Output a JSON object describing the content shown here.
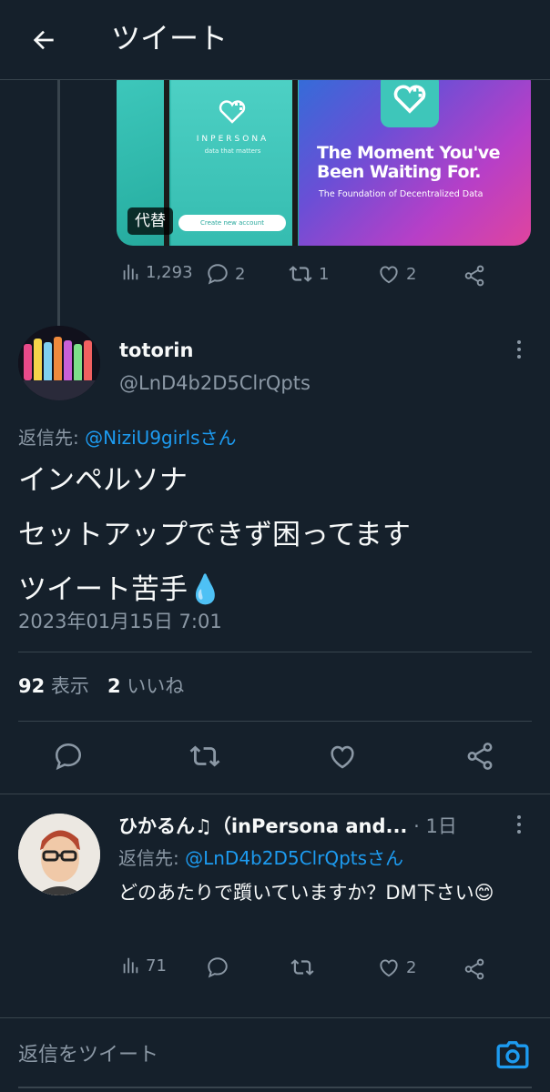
{
  "header": {
    "title": "ツイート",
    "back_icon": "arrow-left-icon"
  },
  "quoted_media": {
    "brand": "INPERSONA",
    "tagline": "data that matters",
    "button": "Create new account",
    "promo_title": "The Moment You've Been Waiting For.",
    "promo_subtitle": "The Foundation of Decentralized Data",
    "alt_badge": "代替"
  },
  "prev_actions": {
    "views": "1,293",
    "replies": "2",
    "retweets": "1",
    "likes": "2"
  },
  "tweet": {
    "display_name": "totorin",
    "username": "@LnD4b2D5ClrQpts",
    "reply_prefix": "返信先: ",
    "reply_handle": "@NiziU9girlsさん",
    "lines": [
      "インペルソナ",
      "セットアップできず困ってます",
      "ツイート苦手💧"
    ],
    "timestamp": "2023年01月15日 7:01",
    "views_count": "92",
    "views_label": "表示",
    "likes_count": "2",
    "likes_label": "いいね"
  },
  "reply": {
    "display_name": "ひかるん♫（inPersona and...",
    "time": "· 1日",
    "reply_prefix": "返信先: ",
    "reply_handle": "@LnD4b2D5ClrQptsさん",
    "text": "どのあたりで躓いていますか？DM下さい😊",
    "views": "71",
    "likes": "2"
  },
  "composer": {
    "placeholder": "返信をツイート"
  },
  "colors": {
    "background": "#15202b",
    "accent": "#1d9bf0",
    "muted": "#8b98a5",
    "divider": "#38444d"
  }
}
